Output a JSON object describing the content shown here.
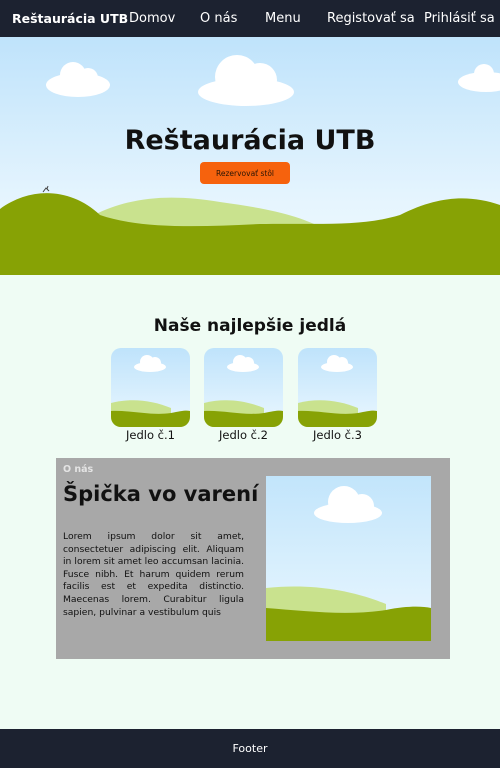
{
  "nav": {
    "brand": "Reštaurácia UTB",
    "links": [
      "Domov",
      "O nás",
      "Menu",
      "Registovať sa",
      "Prihlásiť sa"
    ]
  },
  "hero": {
    "title": "Reštaurácia UTB",
    "button": "Rezervovať stôl"
  },
  "dishes": {
    "title": "Naše najlepšie jedlá",
    "items": [
      {
        "label": "Jedlo č.1"
      },
      {
        "label": "Jedlo č.2"
      },
      {
        "label": "Jedlo č.3"
      }
    ]
  },
  "about": {
    "kicker": "O nás",
    "heading": "Špička vo varení",
    "text": "Lorem ipsum dolor sit amet, consectetuer adipiscing elit. Aliquam in lorem sit amet leo accumsan lacinia. Fusce nibh. Et harum quidem rerum facilis est et expedita distinctio. Maecenas lorem. Curabitur ligula sapien, pulvinar a vestibulum quis"
  },
  "footer": {
    "text": "Footer"
  },
  "colors": {
    "nav_bg": "#1c2230",
    "accent_button": "#f6620d",
    "hill_dark": "#87a205",
    "hill_light": "#c9e28e",
    "about_bg": "#a8a8a8"
  }
}
